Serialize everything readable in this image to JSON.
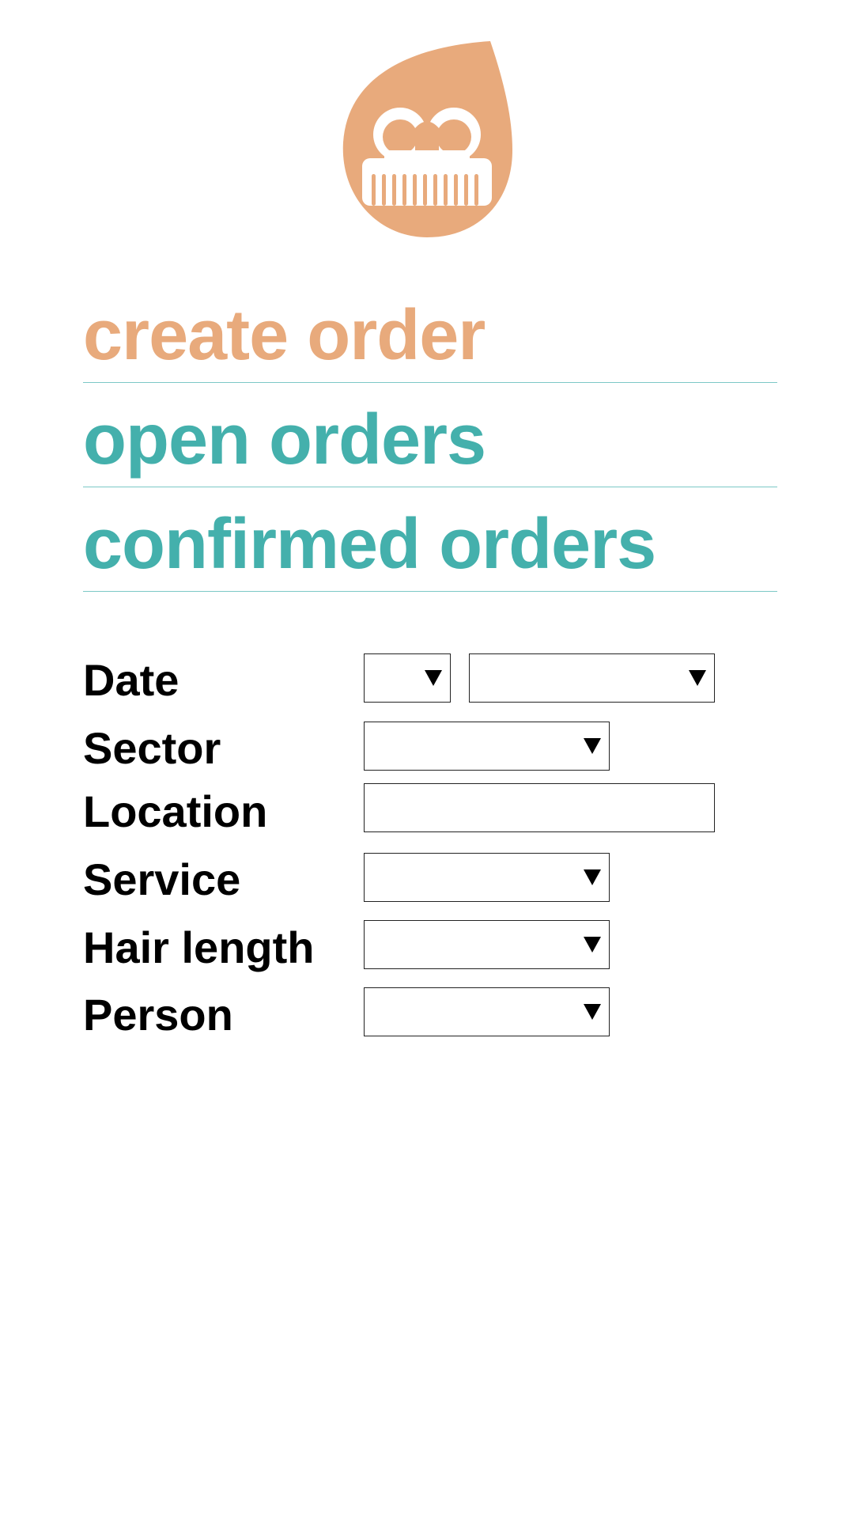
{
  "brand": {
    "logo_icon": "comb-drop-icon",
    "accent_color": "#e8aa7c",
    "teal_color": "#44b0ac"
  },
  "menu": {
    "items": [
      {
        "label": "create order"
      },
      {
        "label": "open orders"
      },
      {
        "label": "confirmed orders"
      }
    ]
  },
  "form": {
    "date_label": "Date",
    "sector_label": "Sector",
    "location_label": "Location",
    "service_label": "Service",
    "hair_length_label": "Hair length",
    "person_label": "Person",
    "date_day_value": "",
    "date_month_value": "",
    "sector_value": "",
    "location_value": "",
    "service_value": "",
    "hair_length_value": "",
    "person_value": ""
  }
}
